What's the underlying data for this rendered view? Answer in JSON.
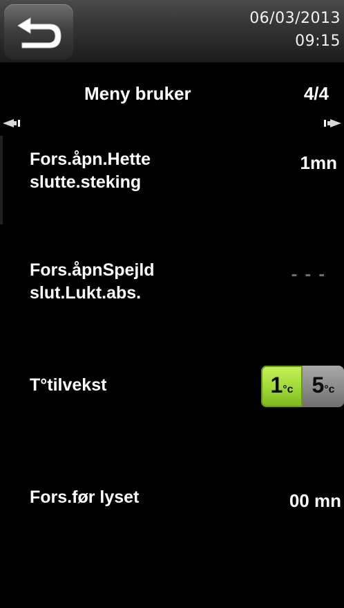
{
  "header": {
    "date": "06/03/2013",
    "time": "09:15",
    "back_icon": "back-arrow-icon"
  },
  "menu": {
    "title": "Meny bruker",
    "page": "4/4"
  },
  "rows": [
    {
      "label_line1": "Fors.åpn.Hette",
      "label_line2": "slutte.steking",
      "value": "1mn"
    },
    {
      "label_line1": "Fors.åpnSpejld",
      "label_line2": "slut.Lukt.abs.",
      "value": "- - -"
    },
    {
      "label_line1": "T°tilvekst",
      "options": [
        {
          "num": "1",
          "unit": "°c",
          "selected": true
        },
        {
          "num": "5",
          "unit": "°c",
          "selected": false
        }
      ]
    },
    {
      "label_line1": "Fors.før lyset",
      "value": "00 mn"
    }
  ],
  "colors": {
    "background": "#000000",
    "selected_option": "#9fd834",
    "unselected_option": "#8a8a8a",
    "disabled_value": "#6f6f6f"
  }
}
